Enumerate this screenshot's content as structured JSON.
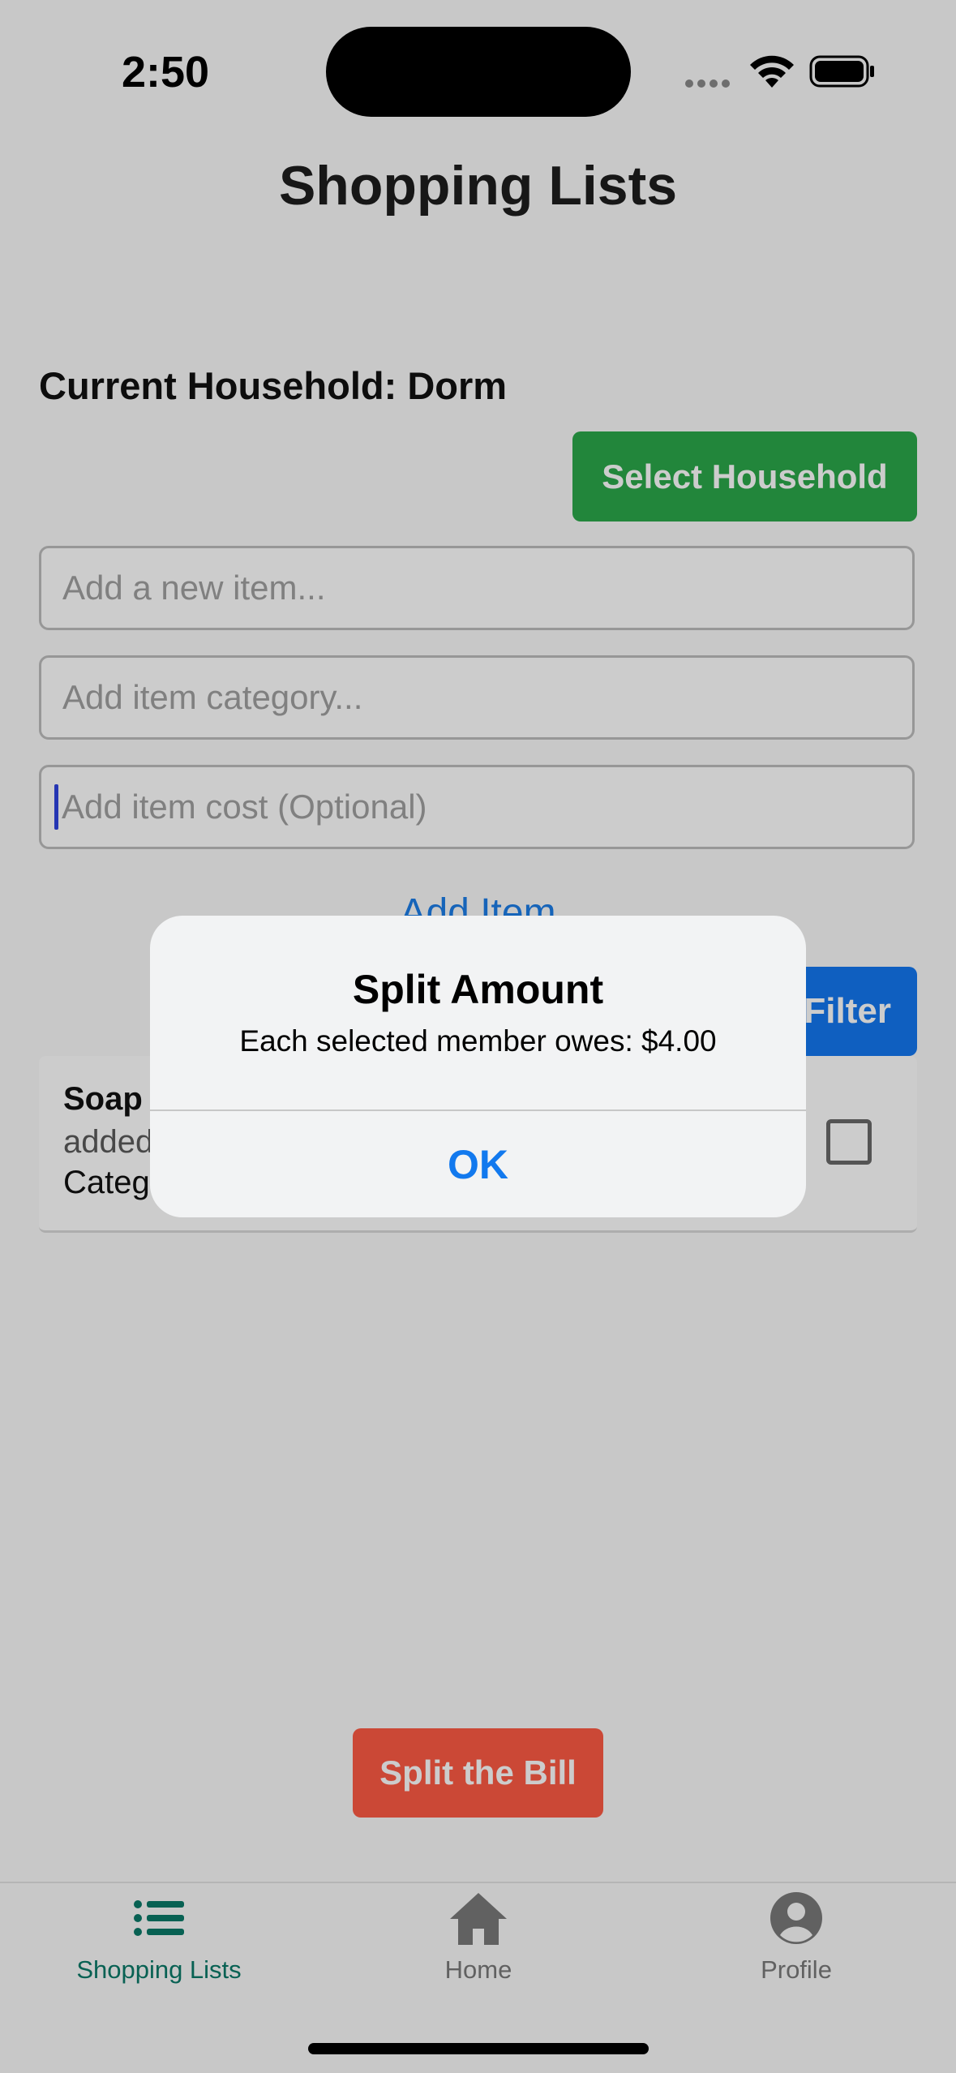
{
  "status_bar": {
    "time": "2:50"
  },
  "page_title": "Shopping Lists",
  "household": {
    "label": "Current Household: Dorm",
    "select_button": "Select Household"
  },
  "form": {
    "item_placeholder": "Add a new item...",
    "category_placeholder": "Add item category...",
    "cost_placeholder": "Add item cost (Optional)",
    "add_button": "Add Item"
  },
  "filter_button": "Filter",
  "items": [
    {
      "name": "Soap",
      "added_text": "added",
      "category_text": "Categ",
      "checked": false
    }
  ],
  "split_button": "Split the Bill",
  "tabs": [
    {
      "label": "Shopping Lists",
      "icon": "list-icon",
      "active": true
    },
    {
      "label": "Home",
      "icon": "home-icon",
      "active": false
    },
    {
      "label": "Profile",
      "icon": "person-circle-icon",
      "active": false
    }
  ],
  "alert": {
    "title": "Split Amount",
    "message": "Each selected member owes: $4.00",
    "ok_label": "OK"
  },
  "colors": {
    "select_button": "#2ba84a",
    "filter_button": "#1377f0",
    "split_button": "#fe5a44",
    "active_tab": "#0a7a68",
    "inactive_tab": "#7a7a7a",
    "link": "#1c7de8"
  }
}
